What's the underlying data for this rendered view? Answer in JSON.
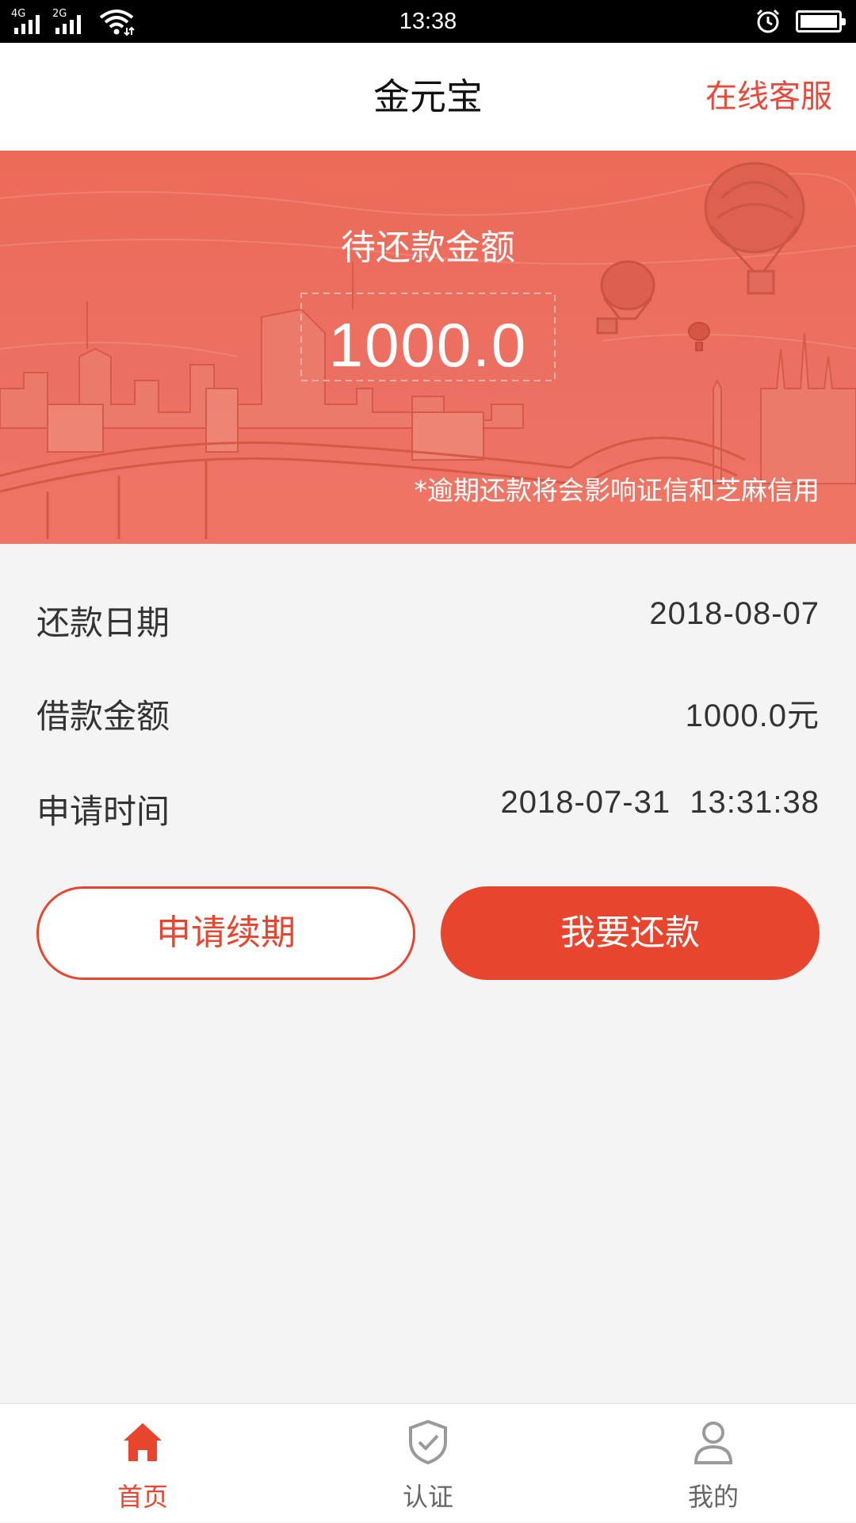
{
  "status_bar": {
    "time": "13:38",
    "signal_1_label": "4G",
    "signal_2_label": "2G",
    "icons": [
      "signal-icon",
      "signal-icon",
      "wifi-icon",
      "alarm-icon",
      "battery-icon"
    ]
  },
  "header": {
    "title": "金元宝",
    "action_label": "在线客服"
  },
  "banner": {
    "label": "待还款金额",
    "amount": "1000.0",
    "note": "*逾期还款将会影响证信和芝麻信用"
  },
  "details": [
    {
      "label": "还款日期",
      "value": "2018-08-07"
    },
    {
      "label": "借款金额",
      "value": "1000.0元"
    },
    {
      "label": "申请时间",
      "value": "2018-07-31  13:31:38"
    }
  ],
  "actions": {
    "renew_label": "申请续期",
    "repay_label": "我要还款"
  },
  "bottom_nav": {
    "items": [
      {
        "label": "首页",
        "icon": "home-icon",
        "active": true
      },
      {
        "label": "认证",
        "icon": "shield-check-icon",
        "active": false
      },
      {
        "label": "我的",
        "icon": "user-icon",
        "active": false
      }
    ]
  },
  "colors": {
    "accent": "#e8452f",
    "banner": "#ec6b59",
    "inactive": "#999999"
  }
}
